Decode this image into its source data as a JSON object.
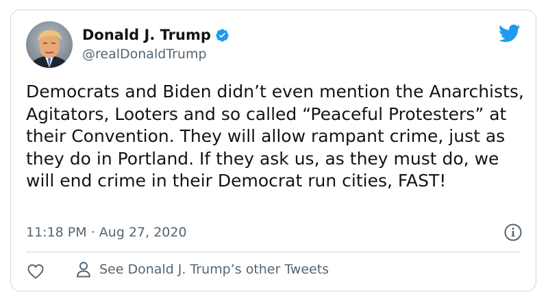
{
  "author": {
    "display_name": "Donald J. Trump",
    "handle": "@realDonaldTrump",
    "verified": true,
    "avatar_icon": "profile-photo"
  },
  "tweet": {
    "text": "Democrats and Biden didn’t even mention the Anarchists, Agitators, Looters and so called “Peaceful Protesters” at their Convention. They will allow rampant crime, just as they do in Portland. If they ask us, as they must do, we will end crime in their Democrat run cities, FAST!",
    "time": "11:18 PM",
    "date": "Aug 27, 2020",
    "separator": "·"
  },
  "actions": {
    "like_icon": "heart-icon",
    "other_tweets_icon": "person-icon",
    "other_tweets_label": "See Donald J. Trump’s other Tweets"
  },
  "colors": {
    "brand_blue": "#1d9bf0",
    "text_primary": "#0f1419",
    "text_secondary": "#536471",
    "border": "#cfd9de"
  }
}
